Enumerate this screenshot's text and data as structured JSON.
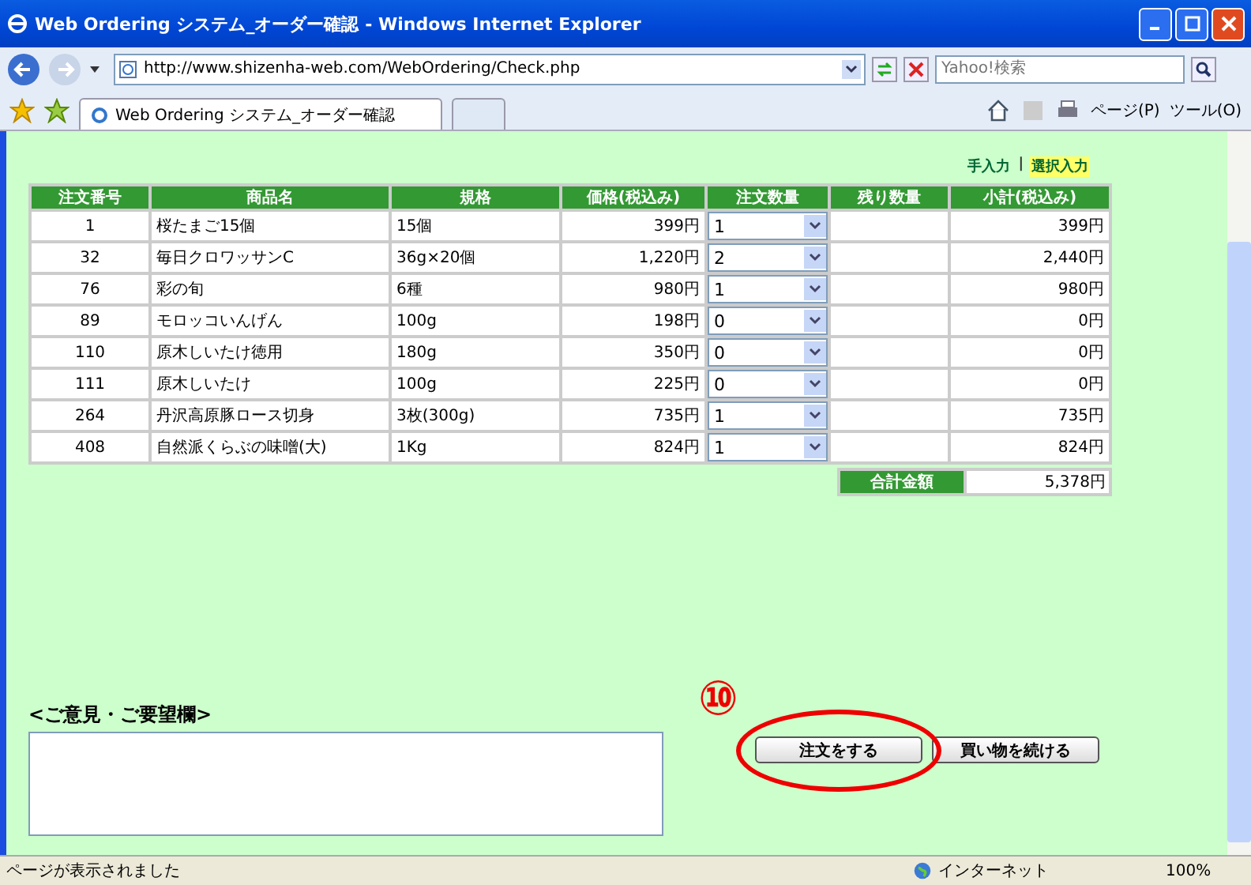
{
  "window": {
    "title": "Web Ordering システム_オーダー確認 - Windows Internet Explorer"
  },
  "address_bar": {
    "url": "http://www.shizenha-web.com/WebOrdering/Check.php",
    "search_placeholder": "Yahoo!検索"
  },
  "tabs": [
    {
      "label": "Web Ordering システム_オーダー確認",
      "selected": true
    }
  ],
  "commands": [
    "ページ(P)",
    "ツール(O)"
  ],
  "input_modes": [
    {
      "label": "手入力",
      "selected": false
    },
    {
      "label": "選択入力",
      "selected": true
    }
  ],
  "mode_separator": "|",
  "table": {
    "columns": [
      "注文番号",
      "商品名",
      "規格",
      "価格(税込み)",
      "注文数量",
      "残り数量",
      "小計(税込み)"
    ],
    "rows": [
      {
        "no": "1",
        "name": "桜たまご15個",
        "spec": "15個",
        "price": "399円",
        "qty": "1",
        "subtotal": "399円"
      },
      {
        "no": "32",
        "name": "毎日クロワッサンC",
        "spec": "36g×20個",
        "price": "1,220円",
        "qty": "2",
        "subtotal": "2,440円"
      },
      {
        "no": "76",
        "name": "彩の旬",
        "spec": "6種",
        "price": "980円",
        "qty": "1",
        "subtotal": "980円"
      },
      {
        "no": "89",
        "name": "モロッコいんげん",
        "spec": "100g",
        "price": "198円",
        "qty": "0",
        "subtotal": "0円"
      },
      {
        "no": "110",
        "name": "原木しいたけ徳用",
        "spec": "180g",
        "price": "350円",
        "qty": "0",
        "subtotal": "0円"
      },
      {
        "no": "111",
        "name": "原木しいたけ",
        "spec": "100g",
        "price": "225円",
        "qty": "0",
        "subtotal": "0円"
      },
      {
        "no": "264",
        "name": "丹沢高原豚ロース切身",
        "spec": "3枚(300g)",
        "price": "735円",
        "qty": "1",
        "subtotal": "735円"
      },
      {
        "no": "408",
        "name": "自然派くらぶの味噌(大)",
        "spec": "1Kg",
        "price": "824円",
        "qty": "1",
        "subtotal": "824円"
      }
    ]
  },
  "total": {
    "label": "合計金額",
    "value": "5,378円"
  },
  "comments": {
    "label": "<ご意見・ご要望欄>"
  },
  "buttons": [
    "注文をする",
    "買い物を続ける"
  ],
  "annotation": {
    "label": "⑩"
  },
  "status_bar": {
    "text": "ページが表示されました",
    "zone": "インターネット",
    "zoom": "100%"
  }
}
